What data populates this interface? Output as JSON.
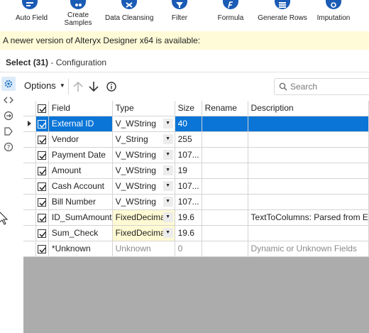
{
  "ribbon": {
    "tools": [
      {
        "label": "Auto Field",
        "icon": "auto-field-icon"
      },
      {
        "label": "Create\nSamples",
        "icon": "create-samples-icon"
      },
      {
        "label": "Data Cleansing",
        "icon": "data-cleansing-icon"
      },
      {
        "label": "Filter",
        "icon": "filter-icon"
      },
      {
        "label": "Formula",
        "icon": "formula-icon"
      },
      {
        "label": "Generate Rows",
        "icon": "generate-rows-icon"
      },
      {
        "label": "Imputation",
        "icon": "imputation-icon"
      }
    ],
    "accent": "#1a5bb5"
  },
  "banner": {
    "text": "A newer version of Alteryx Designer x64 is available:"
  },
  "config": {
    "title": "Select (31)",
    "separator": " - ",
    "subtitle": "Configuration"
  },
  "toolbar": {
    "options_label": "Options",
    "search_placeholder": "Search"
  },
  "grid": {
    "headers": {
      "field": "Field",
      "type": "Type",
      "size": "Size",
      "rename": "Rename",
      "description": "Description"
    },
    "rows": [
      {
        "checked": true,
        "field": "External ID",
        "type": "V_WString",
        "size": "40",
        "rename": "",
        "description": "",
        "selected": true
      },
      {
        "checked": true,
        "field": "Vendor",
        "type": "V_String",
        "size": "255",
        "rename": "",
        "description": ""
      },
      {
        "checked": true,
        "field": "Payment Date",
        "type": "V_WString",
        "size": "107...",
        "rename": "",
        "description": ""
      },
      {
        "checked": true,
        "field": "Amount",
        "type": "V_WString",
        "size": "19",
        "rename": "",
        "description": ""
      },
      {
        "checked": true,
        "field": "Cash Account",
        "type": "V_WString",
        "size": "107...",
        "rename": "",
        "description": ""
      },
      {
        "checked": true,
        "field": "Bill Number",
        "type": "V_WString",
        "size": "107...",
        "rename": "",
        "description": ""
      },
      {
        "checked": true,
        "field": "ID_SumAmount",
        "type": "FixedDecimal",
        "size": "19.6",
        "rename": "",
        "description": "TextToColumns: Parsed from E"
      },
      {
        "checked": true,
        "field": "Sum_Check",
        "type": "FixedDecimal",
        "size": "19.6",
        "rename": "",
        "description": ""
      },
      {
        "checked": true,
        "field": "*Unknown",
        "type": "Unknown",
        "size": "0",
        "rename": "",
        "description": "Dynamic or Unknown Fields"
      }
    ],
    "colors": {
      "selection": "#0a75d7",
      "fixed_decimal_bg": "#fffad3",
      "empty_area": "#acacac"
    }
  }
}
